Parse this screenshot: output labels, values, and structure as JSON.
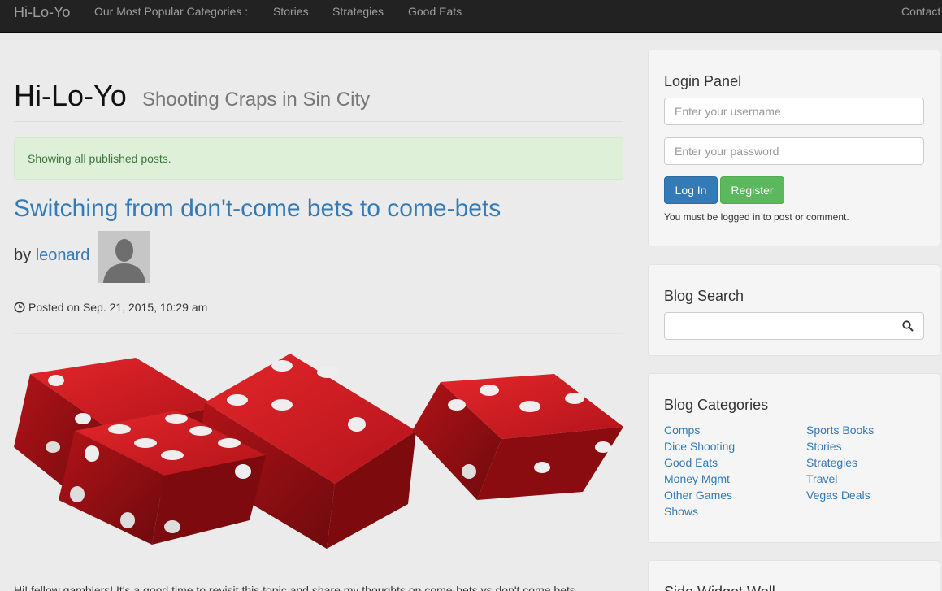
{
  "navbar": {
    "brand": "Hi-Lo-Yo",
    "items": [
      {
        "label": "Our Most Popular Categories :"
      },
      {
        "label": "Stories"
      },
      {
        "label": "Strategies"
      },
      {
        "label": "Good Eats"
      }
    ],
    "contact": "Contact"
  },
  "header": {
    "title": "Hi-Lo-Yo",
    "subtitle": "Shooting Craps in Sin City"
  },
  "alert": {
    "text": "Showing all published posts."
  },
  "post": {
    "title": "Switching from don't-come bets to come-bets",
    "by": "by",
    "author": "leonard",
    "posted": "Posted on Sep. 21, 2015, 10:29 am",
    "excerpt": "Hi! fellow gamblers! It's a good time to revisit this topic and share my thoughts on come-bets vs don't come bets"
  },
  "login": {
    "heading": "Login Panel",
    "username_placeholder": "Enter your username",
    "password_placeholder": "Enter your password",
    "login_label": "Log In",
    "register_label": "Register",
    "note": "You must be logged in to post or comment."
  },
  "search": {
    "heading": "Blog Search"
  },
  "categories": {
    "heading": "Blog Categories",
    "left": [
      "Comps",
      "Dice Shooting",
      "Good Eats",
      "Money Mgmt",
      "Other Games",
      "Shows"
    ],
    "right": [
      "Sports Books",
      "Stories",
      "Strategies",
      "Travel",
      "Vegas Deals"
    ]
  },
  "side_widget": {
    "heading": "Side Widget Well"
  },
  "colors": {
    "navbar_bg": "#222222",
    "link": "#337ab7",
    "success": "#5cb85c",
    "alert_bg": "#dff0d8",
    "dice_red": "#c0161a"
  },
  "icons": [
    "clock-icon",
    "search-icon",
    "avatar-silhouette-icon",
    "dice-image"
  ]
}
